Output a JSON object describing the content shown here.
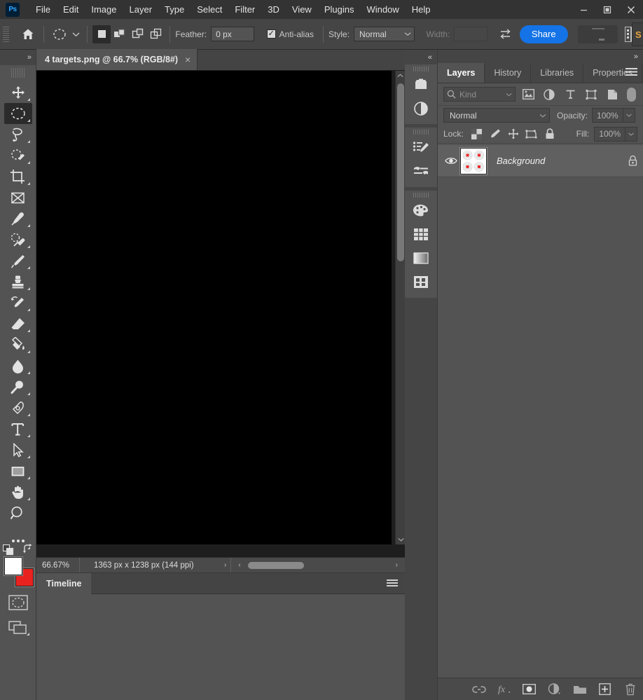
{
  "app": {
    "logo_text": "Ps",
    "menus": [
      "File",
      "Edit",
      "Image",
      "Layer",
      "Type",
      "Select",
      "Filter",
      "3D",
      "View",
      "Plugins",
      "Window",
      "Help"
    ],
    "window_controls": {
      "minimize": "minimize-icon",
      "restore": "restore-icon",
      "close": "close-icon"
    }
  },
  "options_bar": {
    "home_icon": "home-icon",
    "tool_preset_icon": "elliptical-marquee-icon",
    "tool_preset_caret": "chevron-down-icon",
    "selection_modes": [
      {
        "name": "new-selection",
        "active": true
      },
      {
        "name": "add-to-selection",
        "active": false
      },
      {
        "name": "subtract-from-selection",
        "active": false
      },
      {
        "name": "intersect-with-selection",
        "active": false
      }
    ],
    "feather_label": "Feather:",
    "feather_value": "0 px",
    "antialias_label": "Anti-alias",
    "antialias_checked": true,
    "style_label": "Style:",
    "style_value": "Normal",
    "width_label": "Width:",
    "width_value": "",
    "swap_icon": "swap-dimensions-icon",
    "share_label": "Share",
    "workspace_icon": "workspace-switcher-icon",
    "panel_icon": "arrange-documents-icon",
    "select_mask_label": "S"
  },
  "toolbar": {
    "collapse_icon": "expand-toolbar-icon",
    "tools": [
      {
        "name": "move-tool",
        "icon": "move-icon",
        "active": false,
        "hasFlyout": true
      },
      {
        "name": "elliptical-marquee-tool",
        "icon": "elliptical-marquee-icon",
        "active": true,
        "hasFlyout": true
      },
      {
        "name": "lasso-tool",
        "icon": "lasso-icon",
        "active": false,
        "hasFlyout": true
      },
      {
        "name": "quick-selection-tool",
        "icon": "quick-selection-icon",
        "active": false,
        "hasFlyout": true
      },
      {
        "name": "crop-tool",
        "icon": "crop-icon",
        "active": false,
        "hasFlyout": true
      },
      {
        "name": "frame-tool",
        "icon": "frame-icon",
        "active": false,
        "hasFlyout": false
      },
      {
        "name": "eyedropper-tool",
        "icon": "eyedropper-icon",
        "active": false,
        "hasFlyout": true
      },
      {
        "name": "spot-healing-brush-tool",
        "icon": "healing-brush-icon",
        "active": false,
        "hasFlyout": true
      },
      {
        "name": "brush-tool",
        "icon": "brush-icon",
        "active": false,
        "hasFlyout": true
      },
      {
        "name": "clone-stamp-tool",
        "icon": "clone-stamp-icon",
        "active": false,
        "hasFlyout": true
      },
      {
        "name": "history-brush-tool",
        "icon": "history-brush-icon",
        "active": false,
        "hasFlyout": true
      },
      {
        "name": "eraser-tool",
        "icon": "eraser-icon",
        "active": false,
        "hasFlyout": true
      },
      {
        "name": "gradient-tool",
        "icon": "paint-bucket-icon",
        "active": false,
        "hasFlyout": true
      },
      {
        "name": "blur-tool",
        "icon": "blur-droplet-icon",
        "active": false,
        "hasFlyout": true
      },
      {
        "name": "dodge-tool",
        "icon": "dodge-icon",
        "active": false,
        "hasFlyout": true
      },
      {
        "name": "pen-tool",
        "icon": "pen-icon",
        "active": false,
        "hasFlyout": true
      },
      {
        "name": "horizontal-type-tool",
        "icon": "type-icon",
        "active": false,
        "hasFlyout": true
      },
      {
        "name": "path-selection-tool",
        "icon": "path-selection-arrow-icon",
        "active": false,
        "hasFlyout": true
      },
      {
        "name": "rectangle-tool",
        "icon": "rectangle-shape-icon",
        "active": false,
        "hasFlyout": true
      },
      {
        "name": "hand-tool",
        "icon": "hand-icon",
        "active": false,
        "hasFlyout": true
      },
      {
        "name": "zoom-tool",
        "icon": "magnifier-icon",
        "active": false,
        "hasFlyout": false
      },
      {
        "name": "edit-toolbar-tool",
        "icon": "ellipsis-icon",
        "active": false,
        "hasFlyout": true
      }
    ],
    "default_colors_icon": "default-colors-icon",
    "swap_colors_icon": "swap-colors-icon",
    "foreground_color": "#ffffff",
    "background_color": "#e8231f",
    "quick_mask_icon": "quick-mask-icon",
    "screen_mode_icon": "screen-mode-icon"
  },
  "document": {
    "tab_title": "4 targets.png @ 66.7% (RGB/8#)",
    "tab_close_icon": "close-icon",
    "canvas_color": "#000000",
    "scroll_up_icon": "chevron-up-icon",
    "scroll_down_icon": "chevron-down-icon"
  },
  "status_bar": {
    "zoom": "66.67%",
    "dimensions": "1363 px x 1238 px (144 ppi)",
    "expand_icon": "chevron-right-icon",
    "left_arrow_icon": "chevron-left-icon",
    "right_arrow_icon": "chevron-right-icon"
  },
  "timeline": {
    "tab_label": "Timeline",
    "menu_icon": "panel-menu-icon"
  },
  "icon_dock": {
    "collapse_icon": "collapse-panels-icon",
    "groups": [
      {
        "icons": [
          {
            "name": "color-panel-icon"
          },
          {
            "name": "adjustments-panel-icon"
          }
        ]
      },
      {
        "icons": [
          {
            "name": "brush-settings-panel-icon"
          },
          {
            "name": "brushes-panel-icon"
          }
        ]
      },
      {
        "icons": [
          {
            "name": "swatches-panel-icon"
          },
          {
            "name": "patterns-panel-icon"
          },
          {
            "name": "gradients-panel-icon"
          },
          {
            "name": "styles-panel-icon"
          }
        ]
      }
    ]
  },
  "layers_panel": {
    "collapse_icon": "collapse-panel-icon",
    "tabs": [
      {
        "label": "Layers",
        "active": true
      },
      {
        "label": "History",
        "active": false
      },
      {
        "label": "Libraries",
        "active": false
      },
      {
        "label": "Properties",
        "active": false
      }
    ],
    "menu_icon": "panel-menu-icon",
    "filter": {
      "search_icon": "search-icon",
      "kind_label": "Kind",
      "caret_icon": "chevron-down-icon",
      "type_filters": [
        {
          "name": "filter-pixel-layers-icon"
        },
        {
          "name": "filter-adjustment-layers-icon"
        },
        {
          "name": "filter-type-layers-icon"
        },
        {
          "name": "filter-shape-layers-icon"
        },
        {
          "name": "filter-smart-objects-icon"
        }
      ],
      "toggle_name": "filter-toggle-switch"
    },
    "blend_mode_label": "Normal",
    "opacity_label": "Opacity:",
    "opacity_value": "100%",
    "lock_label": "Lock:",
    "lock_buttons": [
      {
        "name": "lock-transparent-pixels-icon"
      },
      {
        "name": "lock-image-pixels-icon"
      },
      {
        "name": "lock-position-icon"
      },
      {
        "name": "lock-artboard-nesting-icon"
      },
      {
        "name": "lock-all-icon"
      }
    ],
    "fill_label": "Fill:",
    "fill_value": "100%",
    "layers": [
      {
        "name": "Background",
        "visible": true,
        "locked": true,
        "thumbnail": "four-targets-thumbnail",
        "selected": true
      }
    ],
    "footer_buttons": [
      {
        "name": "link-layers-button",
        "icon": "link-icon"
      },
      {
        "name": "layer-style-button",
        "icon": "fx-icon"
      },
      {
        "name": "add-layer-mask-button",
        "icon": "mask-icon"
      },
      {
        "name": "new-fill-adjustment-button",
        "icon": "adjustment-circle-icon"
      },
      {
        "name": "new-group-button",
        "icon": "folder-icon"
      },
      {
        "name": "new-layer-button",
        "icon": "plus-square-icon"
      },
      {
        "name": "delete-layer-button",
        "icon": "trash-icon"
      }
    ]
  }
}
